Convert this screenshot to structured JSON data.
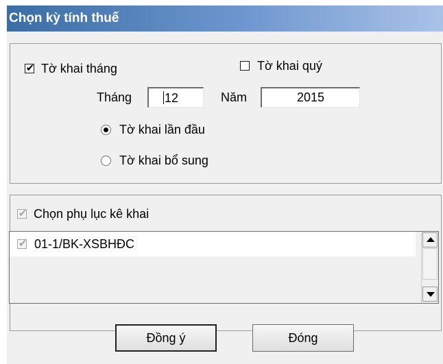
{
  "window": {
    "title": "Chọn kỳ tính thuế"
  },
  "period": {
    "monthly_label": "Tờ khai tháng",
    "monthly_checked": true,
    "quarterly_label": "Tờ khai quý",
    "quarterly_checked": false,
    "month_label": "Tháng",
    "month_value": "12",
    "year_label": "Năm",
    "year_value": "2015",
    "type_options": [
      {
        "label": "Tờ khai lần đầu",
        "selected": true
      },
      {
        "label": "Tờ khai bổ sung",
        "selected": false
      }
    ]
  },
  "appendix": {
    "select_label": "Chọn phụ lục kê khai",
    "select_checked": true,
    "items": [
      {
        "label": "01-1/BK-XSBHĐC",
        "checked": true
      }
    ]
  },
  "buttons": {
    "ok": "Đồng ý",
    "close": "Đóng"
  }
}
